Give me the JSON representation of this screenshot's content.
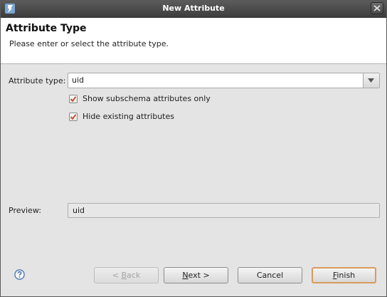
{
  "window": {
    "title": "New Attribute"
  },
  "banner": {
    "title": "Attribute Type",
    "description": "Please enter or select the attribute type."
  },
  "form": {
    "attribute_type_label": "Attribute type:",
    "attribute_type_value": "uid",
    "show_subschema_label": "Show subschema attributes only",
    "show_subschema_checked": true,
    "hide_existing_label": "Hide existing attributes",
    "hide_existing_checked": true,
    "preview_label": "Preview:",
    "preview_value": "uid"
  },
  "buttons": {
    "back": {
      "prefix": "< ",
      "mnemonic": "B",
      "rest": "ack",
      "enabled": false
    },
    "next": {
      "mnemonic": "N",
      "rest": "ext >",
      "enabled": true
    },
    "cancel": {
      "label": "Cancel",
      "enabled": true
    },
    "finish": {
      "mnemonic": "F",
      "rest": "inish",
      "enabled": true
    }
  },
  "colors": {
    "titlebar": "#4a4a4a",
    "default_button_border": "#d99b5c",
    "checkmark": "#c0542a"
  }
}
